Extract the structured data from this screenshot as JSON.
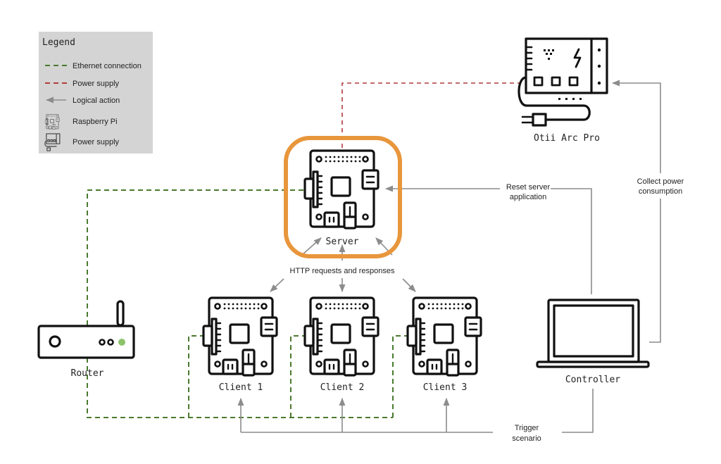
{
  "legend": {
    "title": "Legend",
    "items": [
      {
        "label": "Ethernet connection",
        "kind": "ethernet-line"
      },
      {
        "label": "Power supply",
        "kind": "power-line"
      },
      {
        "label": "Logical action",
        "kind": "logical-arrow"
      },
      {
        "label": "Raspberry Pi",
        "kind": "raspberry-pi-icon"
      },
      {
        "label": "Power supply",
        "kind": "power-supply-icon"
      }
    ]
  },
  "nodes": {
    "power_meter": {
      "label": "Otii Arc Pro",
      "icon": "power-supply-icon"
    },
    "server": {
      "label": "Server",
      "icon": "raspberry-pi-icon",
      "highlighted": true
    },
    "client1": {
      "label": "Client 1",
      "icon": "raspberry-pi-icon"
    },
    "client2": {
      "label": "Client 2",
      "icon": "raspberry-pi-icon"
    },
    "client3": {
      "label": "Client 3",
      "icon": "raspberry-pi-icon"
    },
    "router": {
      "label": "Router",
      "icon": "router-icon"
    },
    "controller": {
      "label": "Controller",
      "icon": "laptop-icon"
    }
  },
  "edges": {
    "reset_server": {
      "label_line1": "Reset server",
      "label_line2": "application"
    },
    "collect_power": {
      "label_line1": "Collect power",
      "label_line2": "consumption"
    },
    "http": {
      "label": "HTTP requests and responses"
    },
    "trigger": {
      "label_line1": "Trigger",
      "label_line2": "scenario"
    }
  },
  "colors": {
    "ethernet": "#4a7a2e",
    "power": "#b23a3a",
    "logical": "#8c8c8c",
    "highlight": "#e8963c",
    "legend_bg": "#d4d4d4",
    "router_led": "#8cc36a"
  }
}
